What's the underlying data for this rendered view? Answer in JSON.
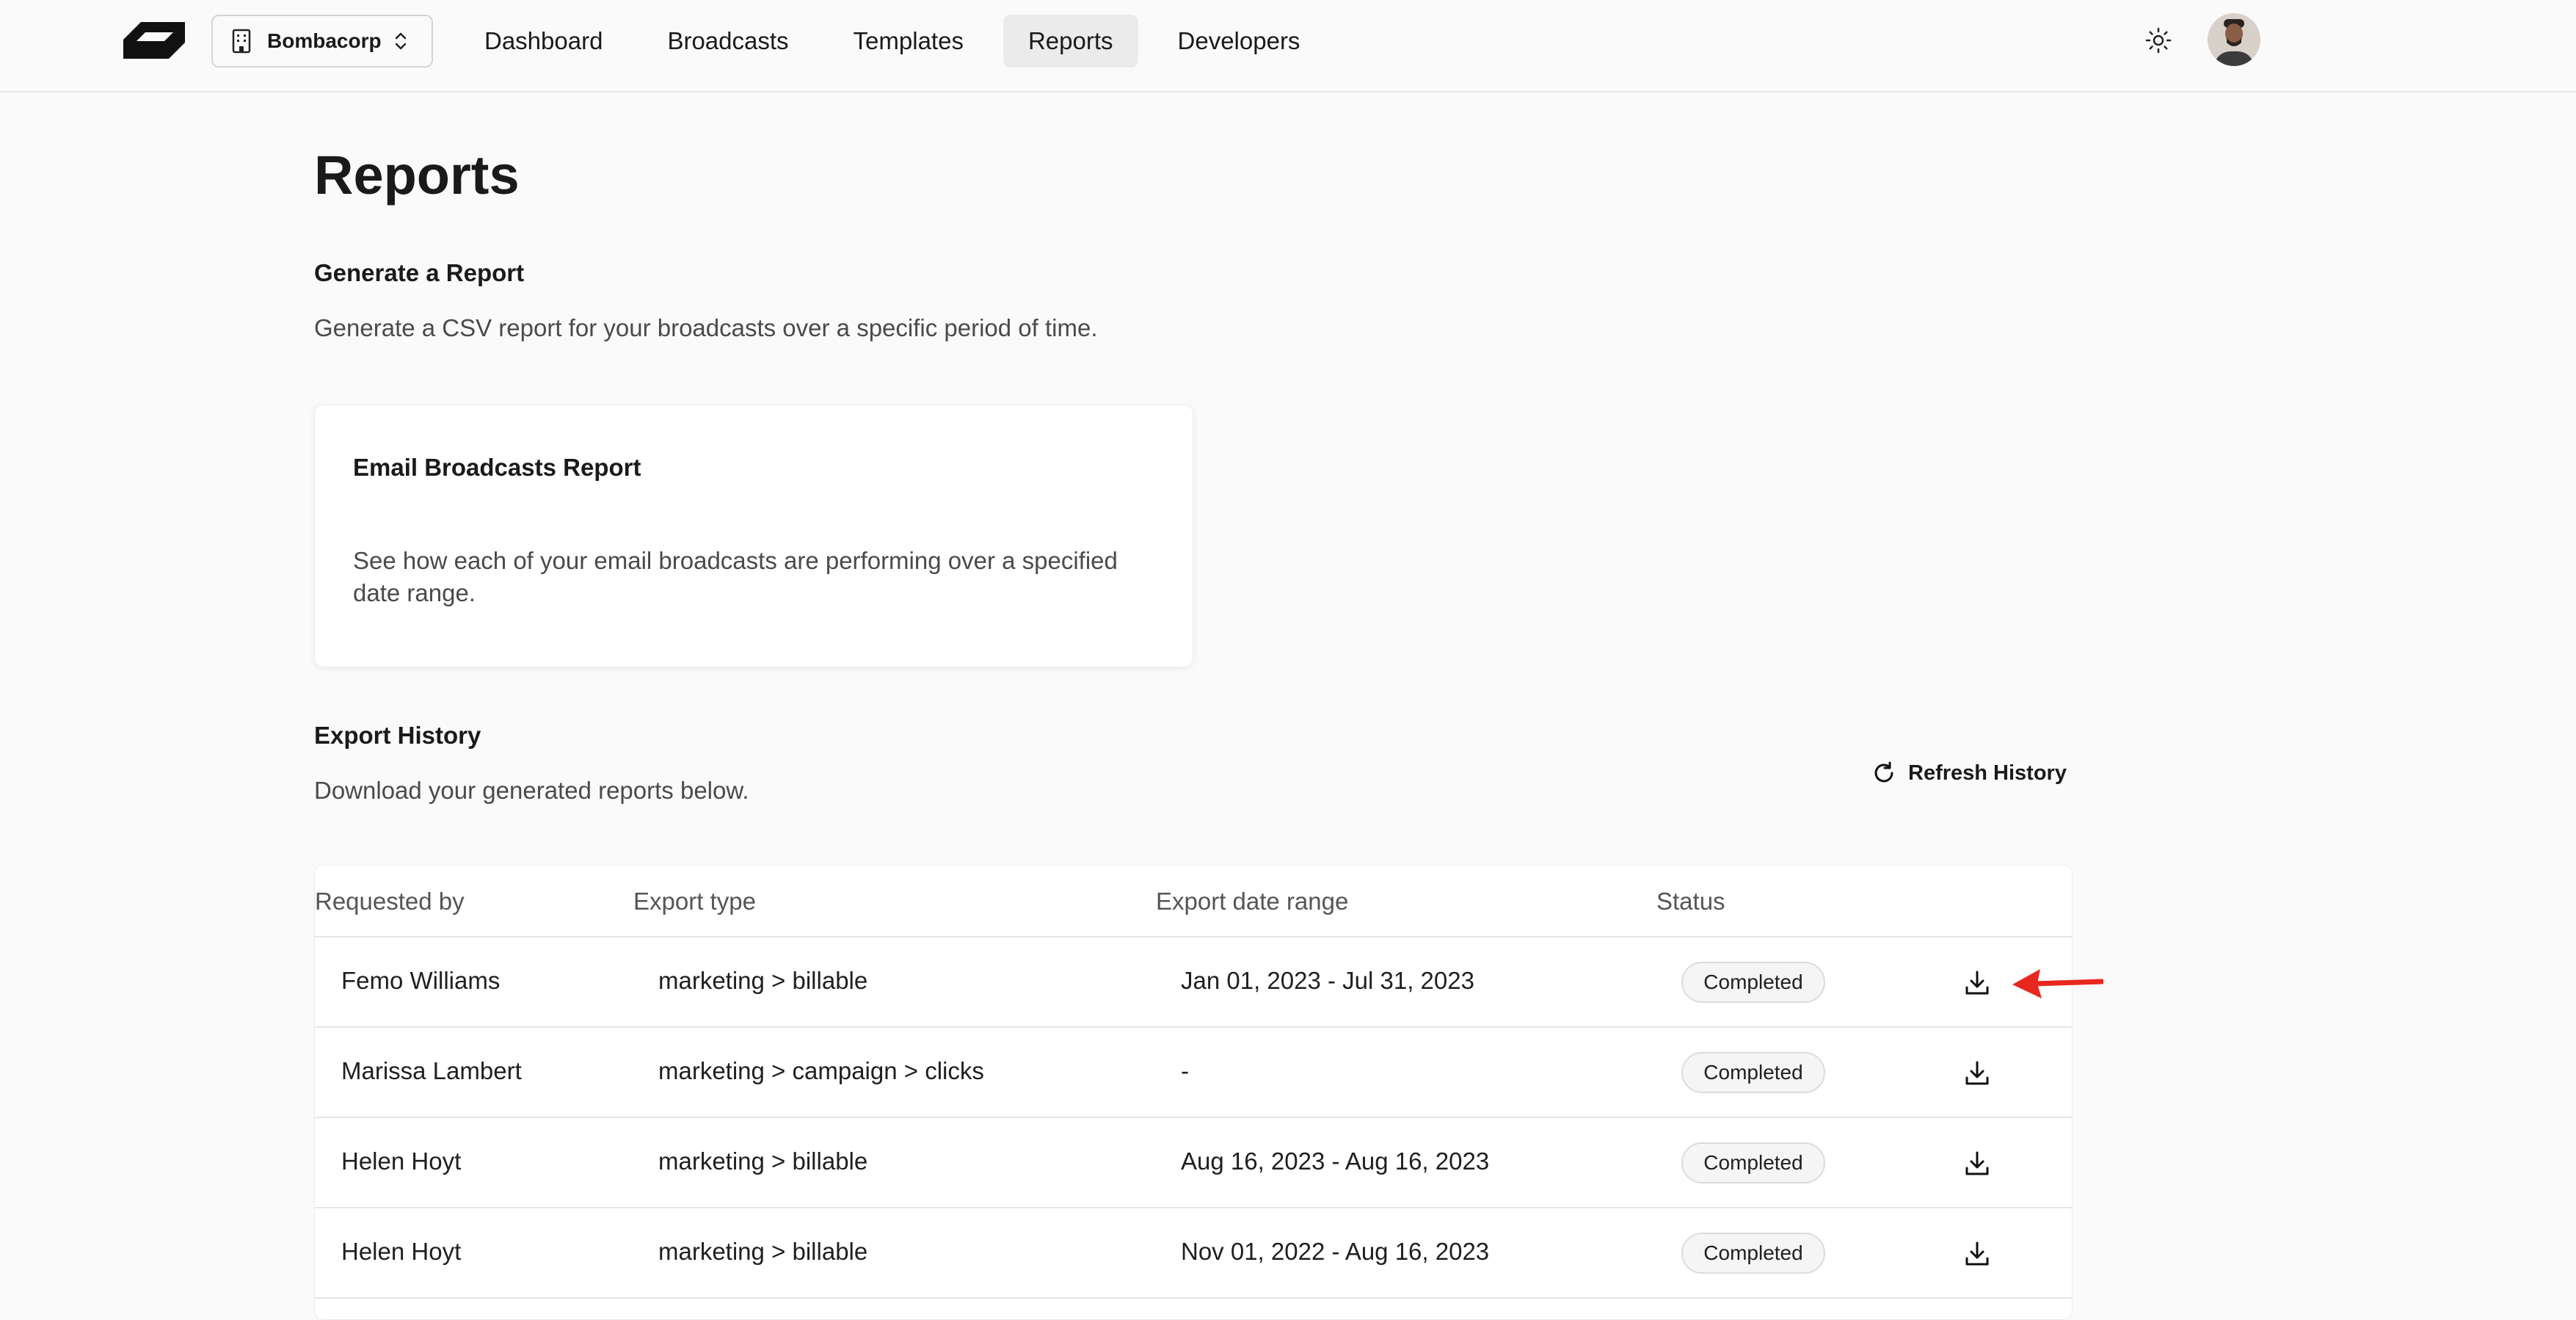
{
  "org_switcher": {
    "name": "Bombacorp"
  },
  "nav": {
    "items": [
      {
        "label": "Dashboard"
      },
      {
        "label": "Broadcasts"
      },
      {
        "label": "Templates"
      },
      {
        "label": "Reports"
      },
      {
        "label": "Developers"
      }
    ],
    "active": "Reports"
  },
  "page": {
    "title": "Reports"
  },
  "generate": {
    "title": "Generate a Report",
    "description": "Generate a CSV report for your broadcasts over a specific period of time."
  },
  "card": {
    "title": "Email Broadcasts Report",
    "description": "See how each of your email broadcasts are performing over a specified date range."
  },
  "export_history": {
    "title": "Export History",
    "description": "Download your generated reports below.",
    "refresh_label": "Refresh History"
  },
  "table": {
    "headers": {
      "requested_by": "Requested by",
      "export_type": "Export type",
      "date_range": "Export date range",
      "status": "Status"
    },
    "rows": [
      {
        "requested_by": "Femo Williams",
        "export_type": "marketing > billable",
        "date_range": "Jan 01, 2023 - Jul 31, 2023",
        "status": "Completed"
      },
      {
        "requested_by": "Marissa Lambert",
        "export_type": "marketing > campaign > clicks",
        "date_range": "-",
        "status": "Completed"
      },
      {
        "requested_by": "Helen Hoyt",
        "export_type": "marketing > billable",
        "date_range": "Aug 16, 2023 - Aug 16, 2023",
        "status": "Completed"
      },
      {
        "requested_by": "Helen Hoyt",
        "export_type": "marketing > billable",
        "date_range": "Nov 01, 2022 - Aug 16, 2023",
        "status": "Completed"
      }
    ]
  },
  "icons": {
    "logo": "brand-logo-icon",
    "org": "building-icon",
    "org_chevron": "chevron-up-down-icon",
    "theme": "sun-icon",
    "refresh": "refresh-icon",
    "download": "download-icon",
    "annotation": "red-arrow-annotation"
  },
  "colors": {
    "annotation_arrow": "#e8281e",
    "active_nav_bg": "#ebebeb"
  }
}
